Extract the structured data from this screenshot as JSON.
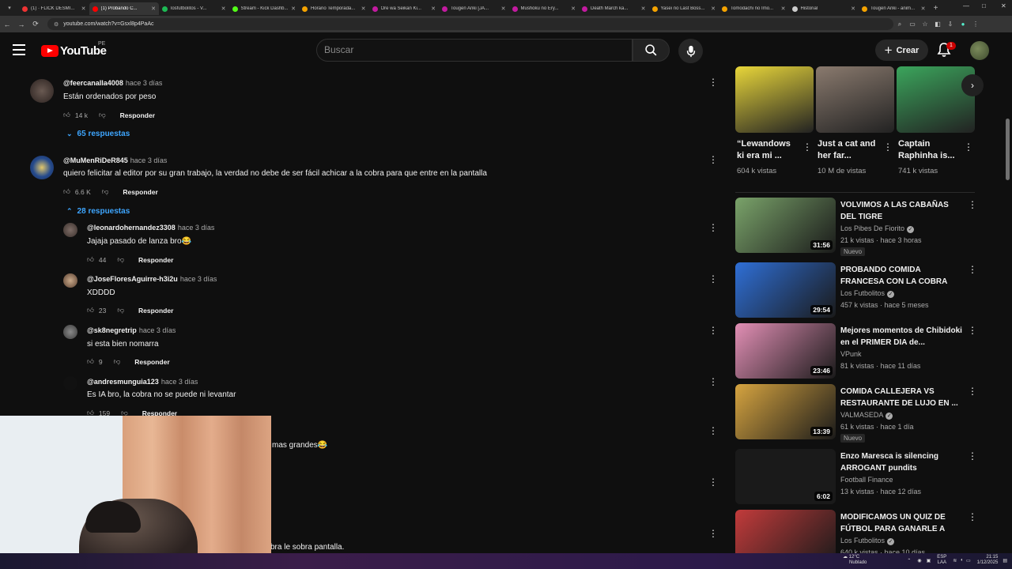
{
  "browser": {
    "tabs": [
      {
        "label": "(1) · FLICK DESMI...",
        "color": "#e33"
      },
      {
        "label": "(1) Probando C...",
        "color": "#f00",
        "active": true
      },
      {
        "label": "losfutbolitos - V...",
        "color": "#1db954"
      },
      {
        "label": "Stream - Kick Dashb...",
        "color": "#53fc18"
      },
      {
        "label": "Horario Temporada...",
        "color": "#f4a300"
      },
      {
        "label": "Ore wa Seikan Ki...",
        "color": "#c31ba0"
      },
      {
        "label": "Tougen Anki [JA...",
        "color": "#c31ba0"
      },
      {
        "label": "Mushoku no Ery...",
        "color": "#c31ba0"
      },
      {
        "label": "Death March ka...",
        "color": "#c31ba0"
      },
      {
        "label": "Yasei no Last Boss...",
        "color": "#f4a300"
      },
      {
        "label": "Tomodachi no Imo...",
        "color": "#f4a300"
      },
      {
        "label": "Historial",
        "color": "#ccc"
      },
      {
        "label": "Tougen Anki - anim...",
        "color": "#f4a300"
      }
    ],
    "url": "youtube.com/watch?v=Gsxl8p4PaAc"
  },
  "header": {
    "logo_text": "YouTube",
    "country_code": "PE",
    "search_placeholder": "Buscar",
    "create_label": "Crear",
    "notification_count": "1"
  },
  "comments": [
    {
      "user": "@feercanalla4008",
      "time": "hace 3 días",
      "text": "Están ordenados por peso",
      "likes": "14 k",
      "reply": "Responder",
      "replies_label": "65 respuestas",
      "expanded": false
    },
    {
      "user": "@MuMenRiDeR845",
      "time": "hace 3 días",
      "text": "quiero felicitar al editor por su gran trabajo, la verdad no debe de ser fácil achicar a la cobra para que entre en la pantalla",
      "likes": "6.6 K",
      "reply": "Responder",
      "replies_label": "28 respuestas",
      "expanded": true
    }
  ],
  "replies": [
    {
      "user": "@leonardohernandez3308",
      "time": "hace 3 días",
      "text": "Jajaja pasado de lanza bro😂",
      "likes": "44",
      "reply": "Responder"
    },
    {
      "user": "@JoseFloresAguirre-h3i2u",
      "time": "hace 3 días",
      "text": "XDDDD",
      "likes": "23",
      "reply": "Responder"
    },
    {
      "user": "@sk8negretrip",
      "time": "hace 3 días",
      "text": "si esta bien nomarra",
      "likes": "9",
      "reply": "Responder"
    },
    {
      "user": "@andresmunguia123",
      "time": "hace 3 días",
      "text": "Es IA bro, la cobra no se puede ni levantar",
      "likes": "159",
      "reply": "Responder"
    }
  ],
  "partial_text": {
    "line1": "mas grandes😂",
    "line2": "bra le sobra pantalla."
  },
  "shorts": [
    {
      "title": "“Lewandows ki era mi ...",
      "views": "604 k vistas",
      "thumb_color": "#e8d63a"
    },
    {
      "title": "Just a cat and her far...",
      "views": "10 M de vistas",
      "thumb_color": "#8a7a6e"
    },
    {
      "title": "Captain Raphinha is...",
      "views": "741 k vistas",
      "thumb_color": "#3ba55c"
    }
  ],
  "recommendations": [
    {
      "title": "VOLVIMOS A LAS CABAÑAS DEL TIGRE",
      "channel": "Los Pibes De Fiorito",
      "verified": true,
      "meta": "21 k vistas · hace 3 horas",
      "badge": "Nuevo",
      "duration": "31:56",
      "thumb_color": "#7aa36a"
    },
    {
      "title": "PROBANDO COMIDA FRANCESA CON LA COBRA",
      "channel": "Los Futbolitos",
      "verified": true,
      "meta": "457 k vistas · hace 5 meses",
      "badge": "",
      "duration": "29:54",
      "thumb_color": "#2f6fd6"
    },
    {
      "title": "Mejores momentos de Chibidoki en el PRIMER DIA de...",
      "channel": "VPunk",
      "verified": false,
      "meta": "81 k vistas · hace 11 días",
      "badge": "",
      "duration": "23:46",
      "thumb_color": "#e28fb5"
    },
    {
      "title": "COMIDA CALLEJERA VS RESTAURANTE DE LUJO EN ...",
      "channel": "VALMASEDA",
      "verified": true,
      "meta": "61 k vistas · hace 1 día",
      "badge": "Nuevo",
      "duration": "13:39",
      "thumb_color": "#d6a440"
    },
    {
      "title": "Enzo Maresca is silencing ARROGANT pundits",
      "channel": "Football Finance",
      "verified": false,
      "meta": "13 k vistas · hace 12 días",
      "badge": "",
      "duration": "6:02",
      "thumb_color": "#1a1a1a"
    },
    {
      "title": "MODIFICAMOS UN QUIZ DE FÚTBOL PARA GANARLE A LA...",
      "channel": "Los Futbolitos",
      "verified": true,
      "meta": "640 k vistas · hace 10 días",
      "badge": "",
      "duration": "",
      "thumb_color": "#c23b3b"
    }
  ],
  "taskbar": {
    "weather_temp": "12°C",
    "weather_desc": "Nublado",
    "lang": "ESP",
    "lang2": "LAA",
    "time": "21:15",
    "date": "1/12/2025"
  }
}
